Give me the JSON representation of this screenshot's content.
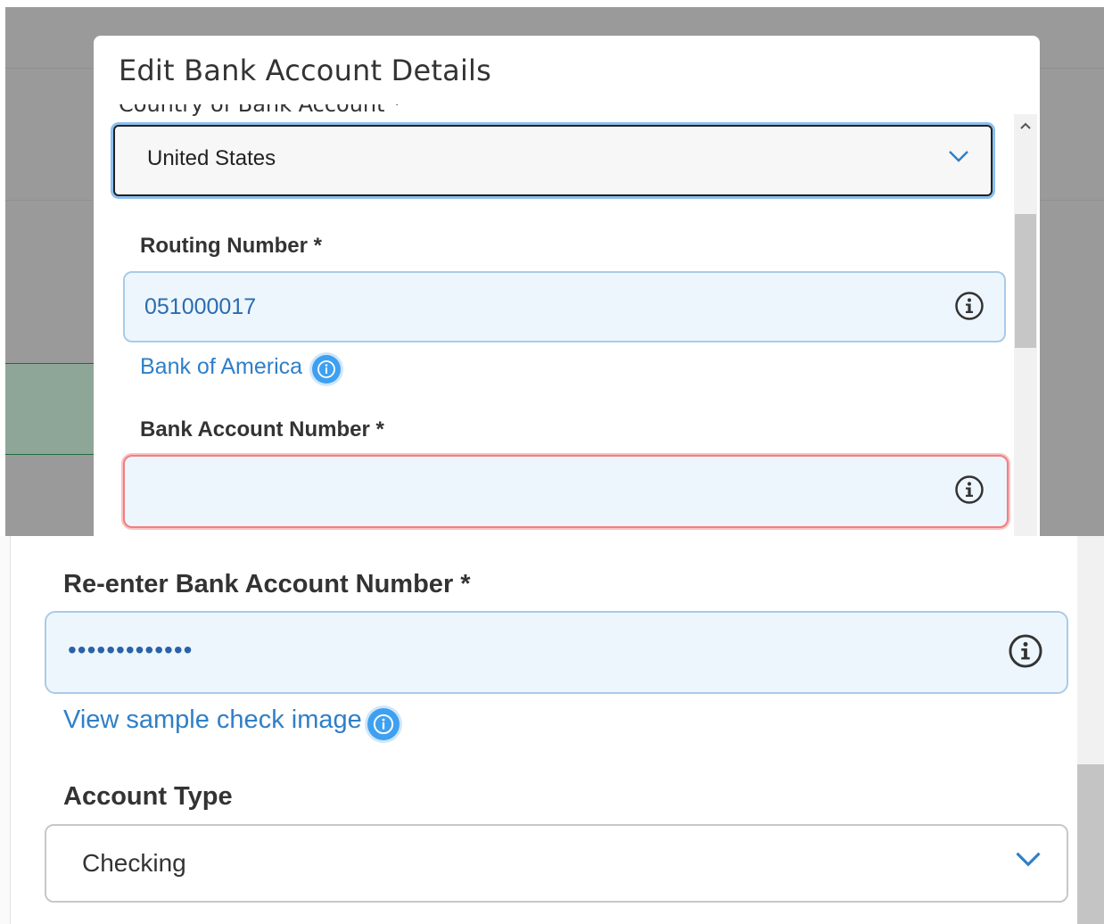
{
  "modal": {
    "title": "Edit Bank Account Details"
  },
  "country": {
    "label_cut": "Country of Bank Account *",
    "selected": "United States"
  },
  "routing": {
    "label": "Routing Number *",
    "value": "051000017",
    "bank_name": "Bank of America"
  },
  "account_number": {
    "label": "Bank Account Number *",
    "value": ""
  },
  "reenter_account": {
    "label": "Re-enter Bank Account Number *",
    "value": "•••••••••••••"
  },
  "sample_check_link": "View sample check image",
  "account_type": {
    "label": "Account Type",
    "selected": "Checking"
  },
  "colors": {
    "accent": "#2f7fc8",
    "error_border": "#f08080",
    "input_bg": "#eef6fd"
  }
}
